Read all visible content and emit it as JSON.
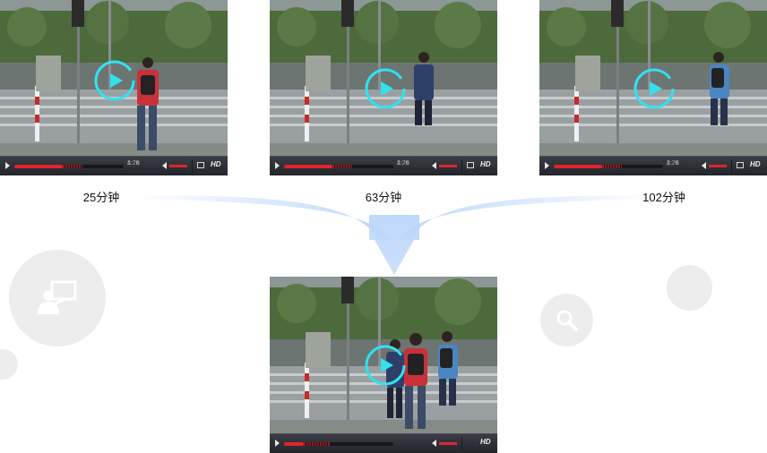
{
  "players": [
    {
      "time_current": "1:26",
      "time_sep": " / ",
      "time_total": "3:22",
      "progress": 0.44,
      "buffered": 0.62,
      "hd_label": "HD"
    },
    {
      "time_current": "1:26",
      "time_sep": " / ",
      "time_total": "3:22",
      "progress": 0.44,
      "buffered": 0.62,
      "hd_label": "HD"
    },
    {
      "time_current": "1:26",
      "time_sep": " / ",
      "time_total": "3:22",
      "progress": 0.44,
      "buffered": 0.62,
      "hd_label": "HD"
    },
    {
      "progress": 0.18,
      "buffered": 0.42,
      "hd_label": "HD"
    }
  ],
  "captions": [
    "25分钟",
    "63分钟",
    "102分钟"
  ],
  "icons": [
    "presentation-user-icon",
    "search-icon",
    "play-icon",
    "merge-arrow-icon"
  ],
  "colors": {
    "accent": "#31e2ee",
    "progress": "#e2232e",
    "arrow": "#b7d4fb",
    "bubble": "#ededed"
  }
}
